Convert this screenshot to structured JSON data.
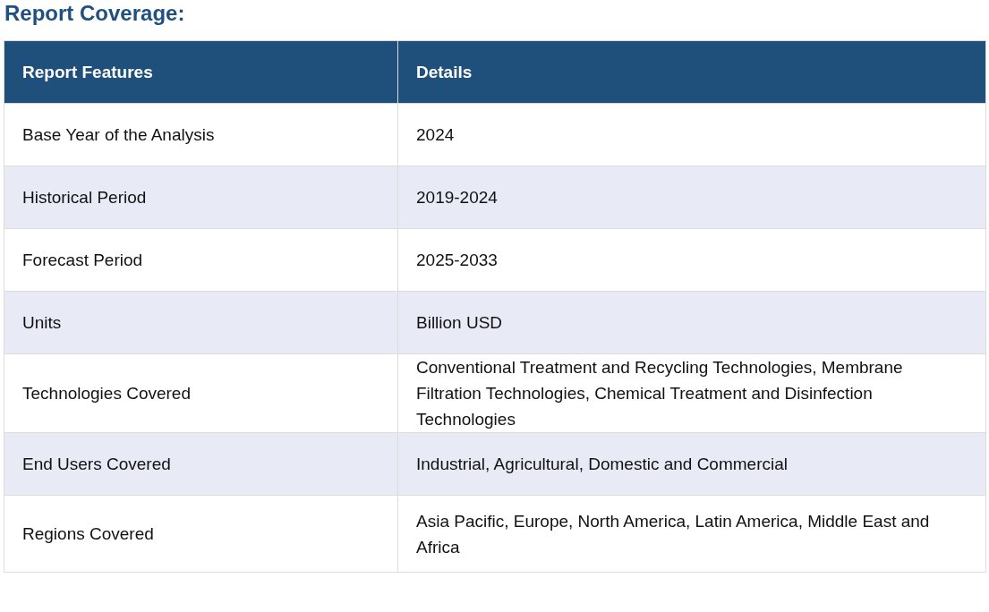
{
  "title": "Report Coverage:",
  "table": {
    "columns": [
      "Report Features",
      "Details"
    ],
    "rows": [
      [
        "Base Year of the Analysis",
        "2024"
      ],
      [
        "Historical Period",
        "2019-2024"
      ],
      [
        "Forecast Period",
        "2025-2033"
      ],
      [
        "Units",
        "Billion USD"
      ],
      [
        "Technologies Covered",
        "Conventional Treatment and Recycling Technologies, Membrane Filtration Technologies, Chemical Treatment and Disinfection Technologies"
      ],
      [
        "End Users Covered",
        "Industrial, Agricultural, Domestic and Commercial"
      ],
      [
        "Regions Covered",
        "Asia Pacific, Europe, North America, Latin America, Middle East and Africa"
      ]
    ]
  }
}
